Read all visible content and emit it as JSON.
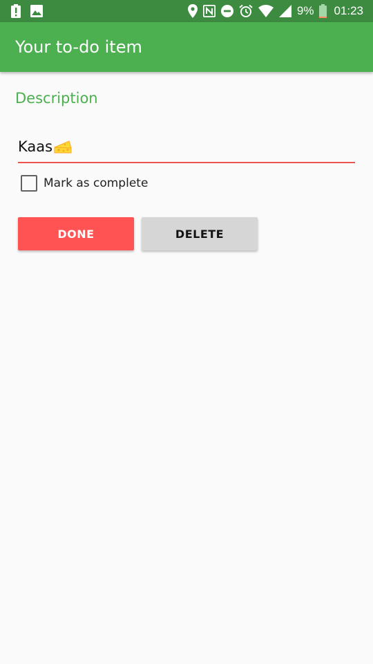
{
  "status_bar": {
    "battery_percent": "9%",
    "time": "01:23",
    "icons": [
      "alert-icon",
      "image-icon",
      "location-icon",
      "nfc-icon",
      "do-not-disturb-icon",
      "alarm-icon",
      "wifi-icon",
      "signal-icon",
      "battery-icon"
    ]
  },
  "app_bar": {
    "title": "Your to-do item"
  },
  "form": {
    "description_label": "Description",
    "description_value": "Kaas",
    "description_emoji": "cheese-icon",
    "complete_label": "Mark as complete",
    "complete_checked": false
  },
  "actions": {
    "done_label": "DONE",
    "delete_label": "DELETE"
  },
  "colors": {
    "status_bar": "#3D8B40",
    "app_bar": "#4CAF50",
    "accent_green": "#4CAF50",
    "input_underline": "#EF5350",
    "done_button": "#FF5252",
    "delete_button": "#D6D6D6",
    "background": "#FAFAFA"
  }
}
